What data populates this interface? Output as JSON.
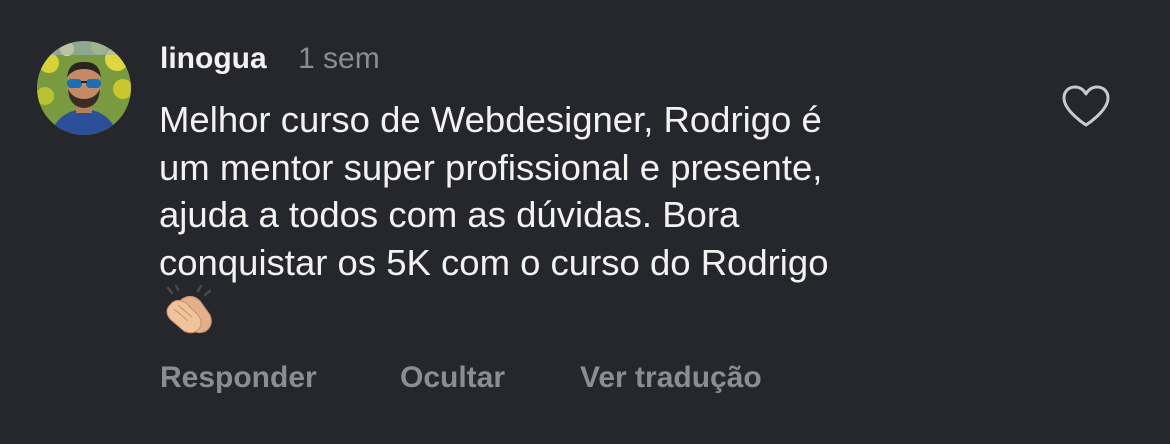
{
  "comment": {
    "username": "linogua",
    "time": "1 sem",
    "text_lines": [
      "Melhor curso de Webdesigner, Rodrigo é",
      "um mentor super profissional e presente,",
      "ajuda a todos com as dúvidas. Bora",
      "conquistar os 5K com o curso do Rodrigo"
    ],
    "emoji": "clapping-hands-emoji",
    "like_icon": "heart-outline-icon",
    "actions": {
      "reply": "Responder",
      "hide": "Ocultar",
      "translate": "Ver tradução"
    }
  },
  "colors": {
    "background": "#25272c",
    "text": "#f2f2f2",
    "muted": "#8a8d93"
  }
}
